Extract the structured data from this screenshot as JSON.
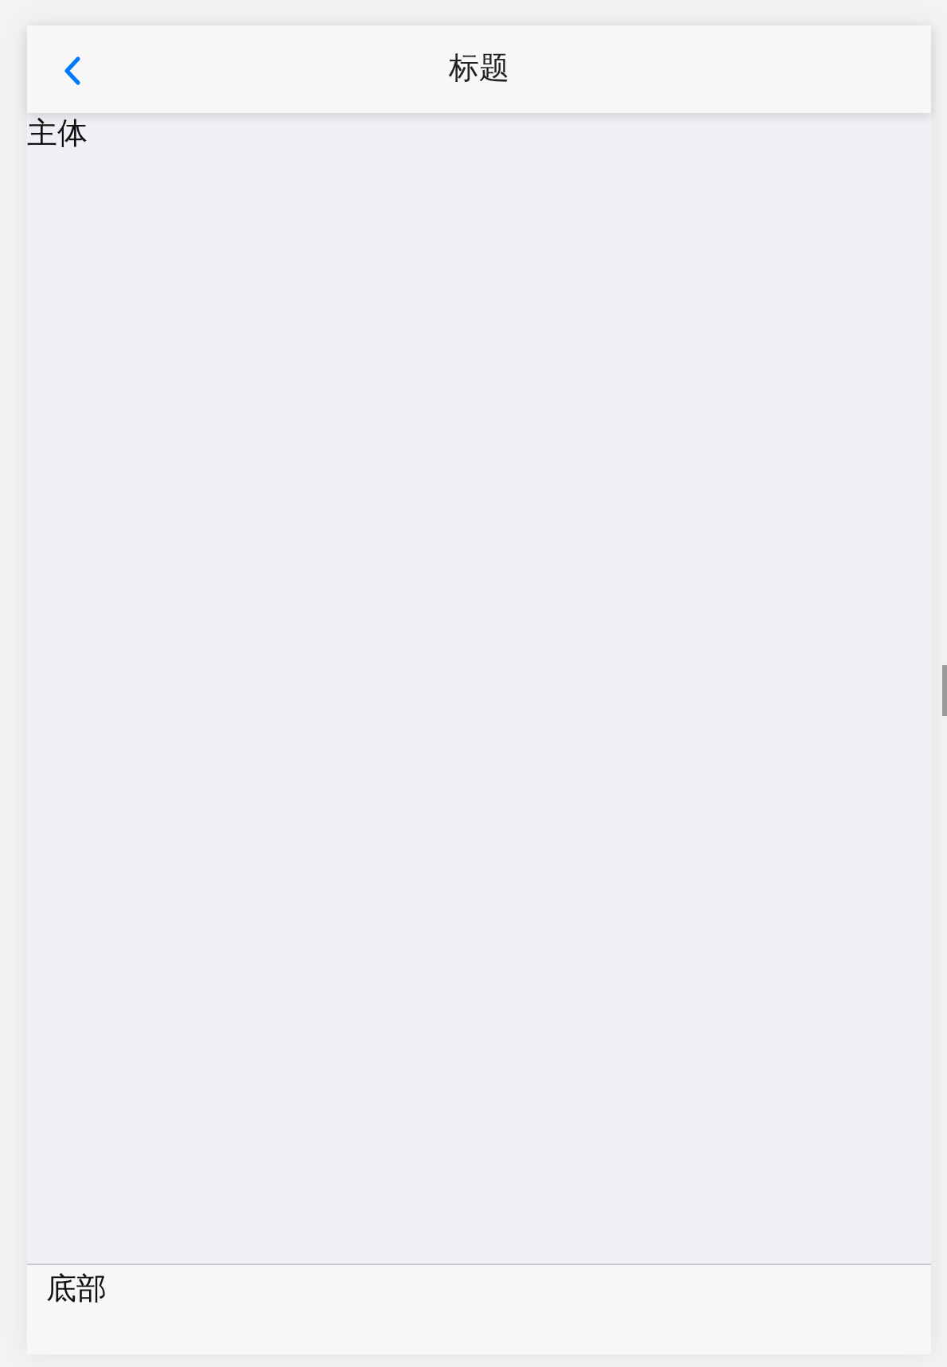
{
  "header": {
    "title": "标题"
  },
  "body": {
    "text": "主体"
  },
  "footer": {
    "text": "底部"
  }
}
